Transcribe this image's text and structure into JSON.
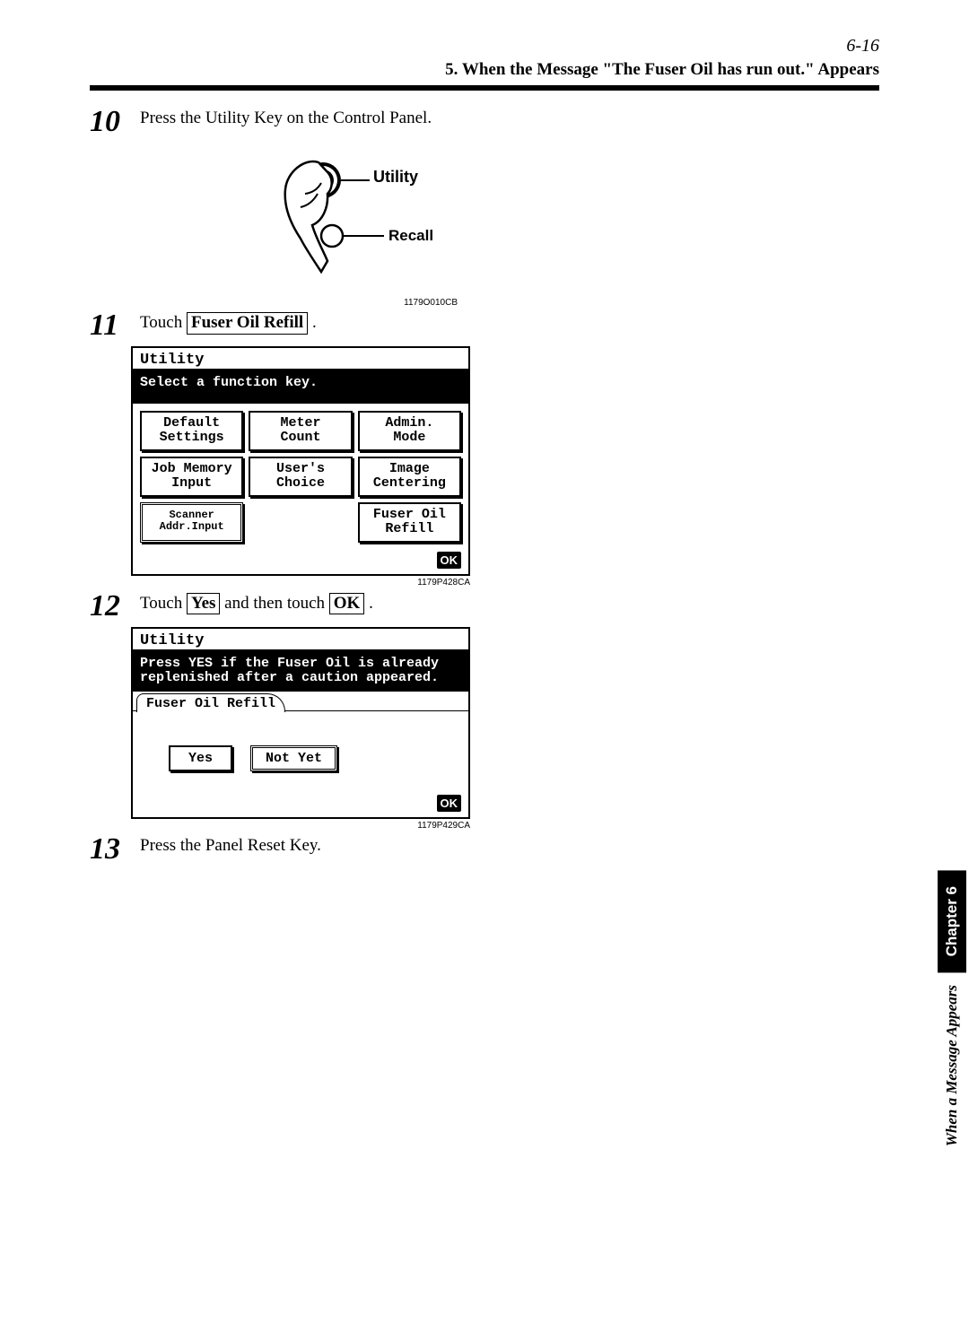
{
  "header": {
    "page_ref": "6-16"
  },
  "subheader": "5. When the Message \"The Fuser Oil has run out.\" Appears",
  "steps": [
    {
      "no": "10",
      "text": "Press the Utility Key on the Control Panel."
    },
    {
      "no": "11",
      "prefix": "Touch ",
      "boxed": "Fuser Oil Refill",
      "suffix": " ."
    },
    {
      "no": "12",
      "prefix": "Touch ",
      "boxed1": "Yes",
      "mid": " and then touch ",
      "boxed2": "OK",
      "suffix": " ."
    },
    {
      "no": "13",
      "text": "Press the Panel Reset Key."
    }
  ],
  "illus": {
    "utility_label": "Utility",
    "recall_label": "Recall",
    "code": "1179O010CB"
  },
  "lcd1": {
    "title": "Utility",
    "bar": "Select a function key.",
    "buttons": [
      "Default\nSettings",
      "Meter\nCount",
      "Admin.\nMode",
      "Job Memory\nInput",
      "User's\nChoice",
      "Image\nCentering",
      "Scanner\nAddr.Input",
      "",
      "Fuser Oil\nRefill"
    ],
    "ok": "OK",
    "code": "1179P428CA"
  },
  "lcd2": {
    "title": "Utility",
    "bar": "Press YES if the Fuser Oil is already\nreplenished after a caution appeared.",
    "tab": "Fuser Oil Refill",
    "yes": "Yes",
    "not_yet": "Not Yet",
    "ok": "OK",
    "code": "1179P429CA"
  },
  "sidebar": {
    "chapter": "Chapter 6",
    "title": "When a Message Appears"
  }
}
